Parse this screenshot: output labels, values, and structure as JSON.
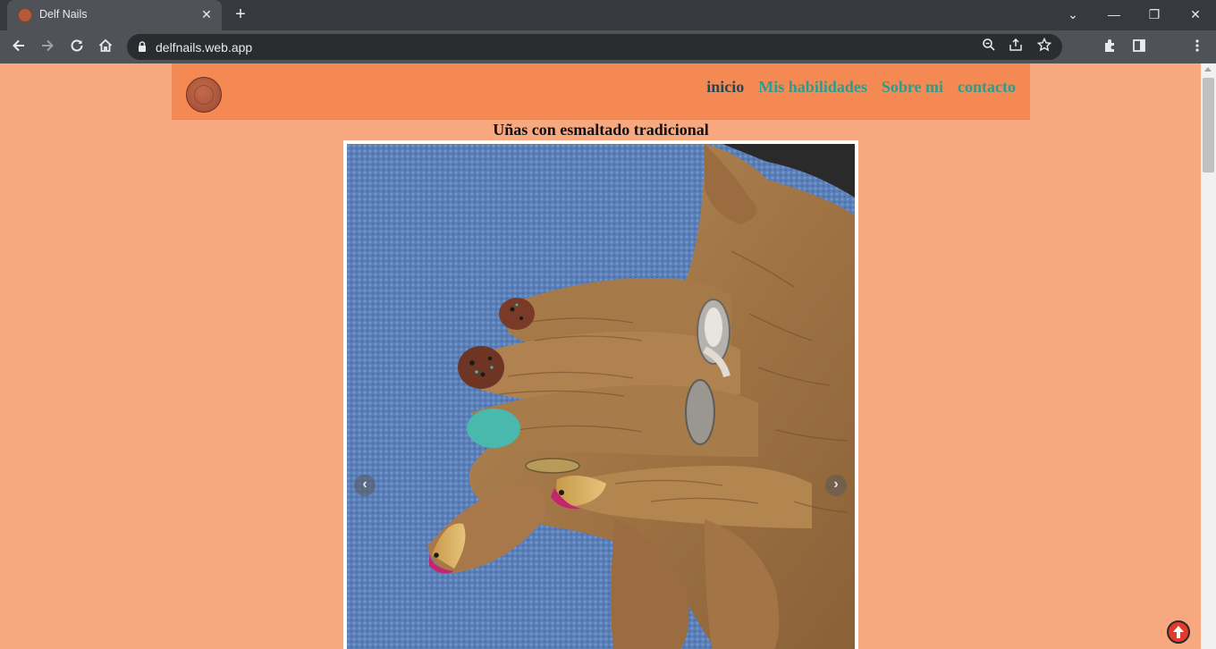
{
  "browser": {
    "tab_title": "Delf Nails",
    "tab_close": "✕",
    "new_tab": "+",
    "url": "delfnails.web.app",
    "icons": [
      "back-icon",
      "forward-icon",
      "reload-icon",
      "home-icon",
      "lock-icon",
      "zoom-icon",
      "share-icon",
      "star-icon",
      "extensions-icon",
      "sidepanel-icon",
      "menu-icon"
    ]
  },
  "window_controls": {
    "tab_search": "⌄",
    "minimize": "—",
    "restore": "❐",
    "close": "✕"
  },
  "nav": {
    "links": [
      "inicio",
      "Mis habilidades",
      "Sobre mi",
      "contacto"
    ],
    "active": "inicio",
    "colors": {
      "background": "#f58954",
      "link": "#2a9d8f",
      "active_link": "#264653"
    }
  },
  "gallery": {
    "title": "Uñas con esmaltado tradicional",
    "prev_label": "‹",
    "next_label": "›"
  },
  "colors": {
    "page_background": "#f8a87e",
    "scroll_top_button": "#e23b2e"
  }
}
